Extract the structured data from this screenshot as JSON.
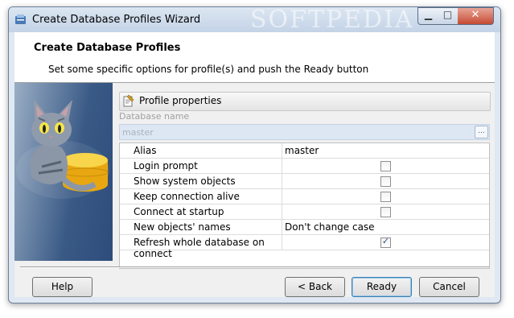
{
  "window": {
    "title": "Create Database Profiles Wizard",
    "watermark": "SOFTPEDIA",
    "controls": {
      "minimize": "▁",
      "maximize": "□",
      "close": "✕"
    }
  },
  "header": {
    "title": "Create Database Profiles",
    "subtitle": "Set some specific options for profile(s) and push the Ready button"
  },
  "group": {
    "label": "Profile properties"
  },
  "database": {
    "label": "Database name",
    "value": "master",
    "browse_label": "..."
  },
  "properties": [
    {
      "name": "Alias",
      "type": "text",
      "value": "master"
    },
    {
      "name": "Login prompt",
      "type": "checkbox",
      "checked": false
    },
    {
      "name": "Show system objects",
      "type": "checkbox",
      "checked": false
    },
    {
      "name": "Keep connection alive",
      "type": "checkbox",
      "checked": false
    },
    {
      "name": "Connect at startup",
      "type": "checkbox",
      "checked": false
    },
    {
      "name": "New objects' names",
      "type": "text",
      "value": "Don't change case"
    },
    {
      "name": "Refresh whole database on connect",
      "type": "checkbox",
      "checked": true,
      "check_mark": "✓"
    }
  ],
  "buttons": {
    "help": "Help",
    "back": "< Back",
    "ready": "Ready",
    "cancel": "Cancel"
  },
  "colors": {
    "titlebar": "#c3d3e6",
    "side_panel": "#3a5a86",
    "database_field": "#dce7f3",
    "default_button_border": "#3c7fb1"
  }
}
